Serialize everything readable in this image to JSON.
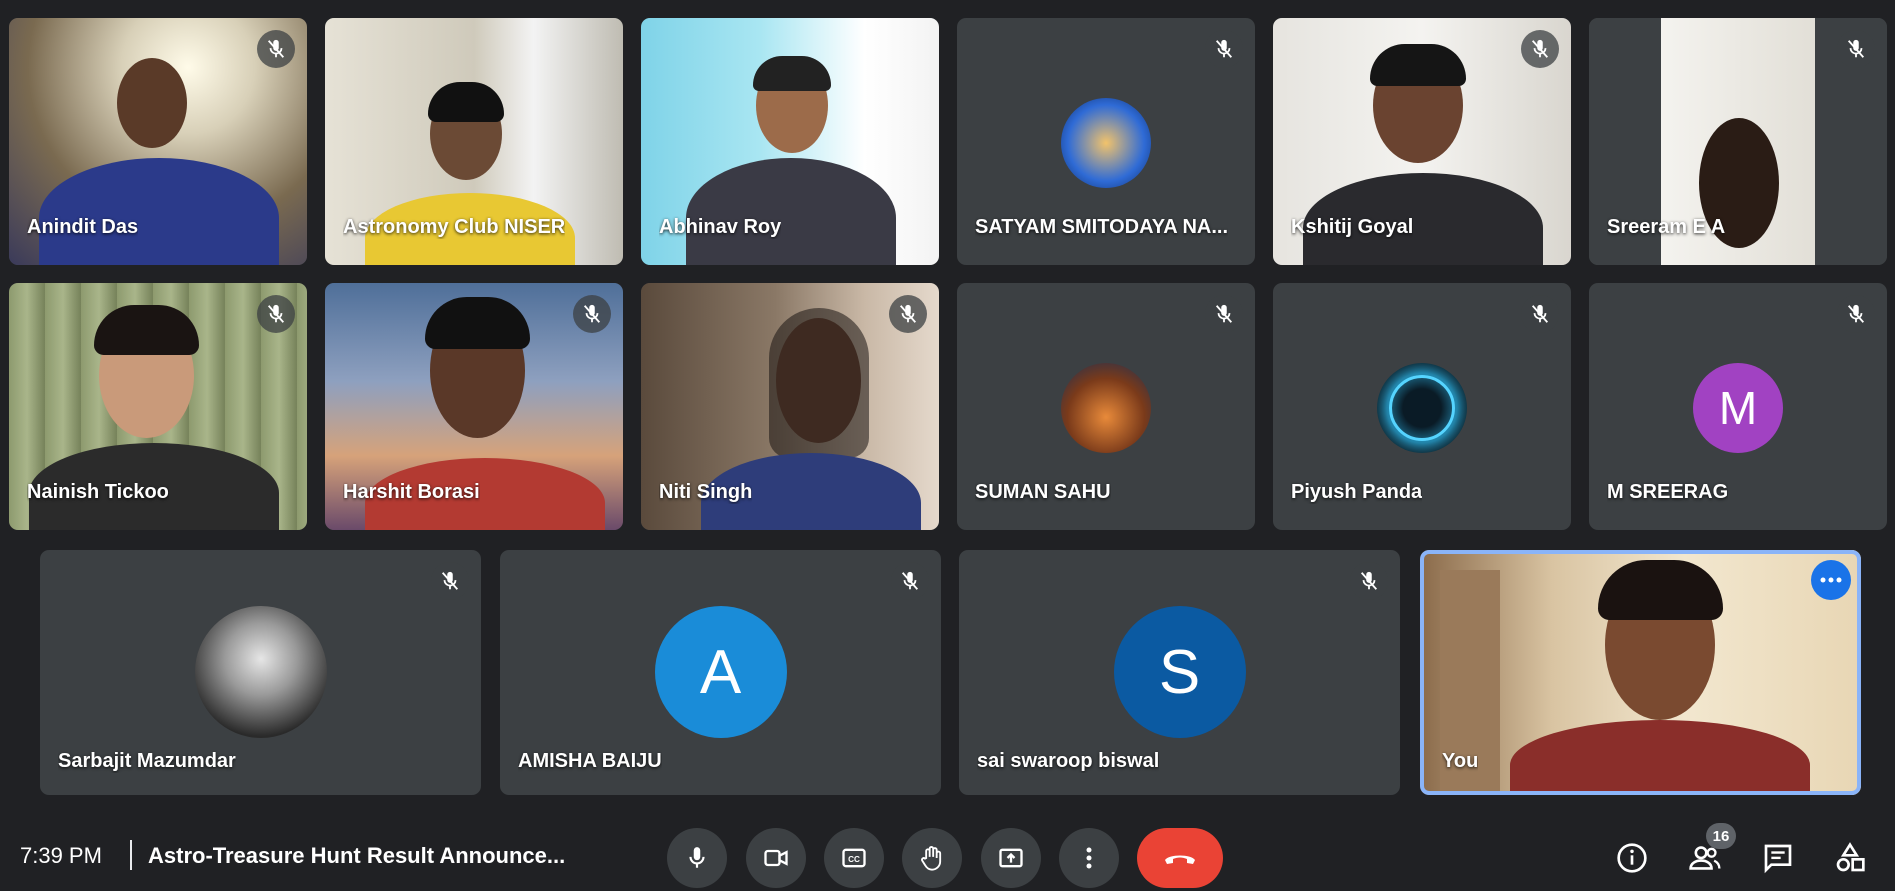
{
  "participants": [
    {
      "name": "Anindit Das",
      "avatar_letter": ""
    },
    {
      "name": "Astronomy Club NISER",
      "avatar_letter": ""
    },
    {
      "name": "Abhinav Roy",
      "avatar_letter": ""
    },
    {
      "name": "SATYAM SMITODAYA NA...",
      "avatar_letter": ""
    },
    {
      "name": "Kshitij Goyal",
      "avatar_letter": ""
    },
    {
      "name": "Sreeram E A",
      "avatar_letter": ""
    },
    {
      "name": "Nainish Tickoo",
      "avatar_letter": ""
    },
    {
      "name": "Harshit Borasi",
      "avatar_letter": ""
    },
    {
      "name": "Niti Singh",
      "avatar_letter": ""
    },
    {
      "name": "SUMAN SAHU",
      "avatar_letter": ""
    },
    {
      "name": "Piyush Panda",
      "avatar_letter": ""
    },
    {
      "name": "M SREERAG",
      "avatar_letter": "M"
    },
    {
      "name": "Sarbajit Mazumdar",
      "avatar_letter": ""
    },
    {
      "name": "AMISHA BAIJU",
      "avatar_letter": "A"
    },
    {
      "name": "sai swaroop biswal",
      "avatar_letter": "S"
    },
    {
      "name": "You",
      "avatar_letter": ""
    }
  ],
  "bottom_bar": {
    "time": "7:39 PM",
    "meeting_title": "Astro-Treasure Hunt Result Announce...",
    "participant_count": "16"
  },
  "colors": {
    "background": "#202124",
    "tile": "#3c4043",
    "end_call": "#ea4335",
    "self_border": "#8ab4f8",
    "avatar_m": "#a142c2",
    "avatar_a": "#1a8cd8",
    "avatar_s": "#0b5aa2"
  },
  "icons": [
    "mic-icon",
    "camera-icon",
    "captions-icon",
    "raise-hand-icon",
    "present-icon",
    "more-vert-icon",
    "end-call-icon",
    "info-icon",
    "people-icon",
    "chat-icon",
    "activities-icon",
    "mic-off-icon"
  ]
}
